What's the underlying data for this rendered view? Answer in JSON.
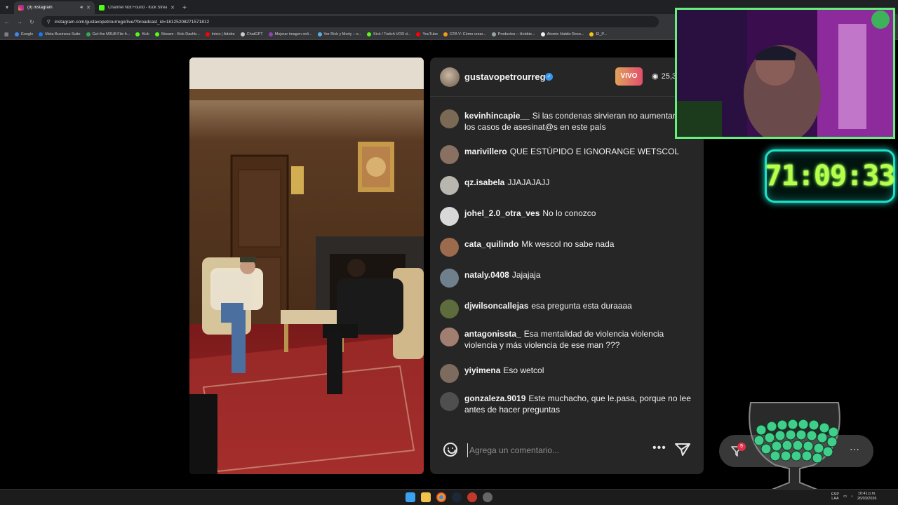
{
  "browser": {
    "tabs": [
      {
        "label": "(9) Instagram",
        "active": true
      },
      {
        "label": "Channel Not Found - Kick Strea...",
        "active": false
      }
    ],
    "url": "instagram.com/gustavopetrourrego/live/?broadcast_id=18125208271571812",
    "bookmarks": [
      {
        "label": "Google",
        "color": "#4285f4"
      },
      {
        "label": "Meta Business Suite",
        "color": "#1877f2"
      },
      {
        "label": "Get the M3U8 File fr...",
        "color": "#34a853"
      },
      {
        "label": "Kick",
        "color": "#53fc18"
      },
      {
        "label": "Stream - Kick Dashb...",
        "color": "#53fc18"
      },
      {
        "label": "Inicio | Adobe",
        "color": "#ff0000"
      },
      {
        "label": "ChatGPT",
        "color": "#cccccc"
      },
      {
        "label": "Mejorar imagen onli...",
        "color": "#8e44ad"
      },
      {
        "label": "Ver Rick y Morty – o...",
        "color": "#5dade2"
      },
      {
        "label": "Kick / Twitch VOD d...",
        "color": "#53fc18"
      },
      {
        "label": "YouTube",
        "color": "#ff0000"
      },
      {
        "label": "GTA V: Cómo crear...",
        "color": "#f39c12"
      },
      {
        "label": "Productos – Hobbie...",
        "color": "#95a5a6"
      },
      {
        "label": "Atomic Habits Reso...",
        "color": "#ecf0f1"
      },
      {
        "label": "El_P...",
        "color": "#f1c40f"
      }
    ]
  },
  "live": {
    "host_name": "gustavopetrourrego",
    "live_label": "VIVO",
    "viewer_count": "25,3",
    "comment_placeholder": "Agrega un comentario..."
  },
  "comments": [
    {
      "user": "kevinhincapie__",
      "text": "Si las condenas sirvieran no aumentaría los casos de asesinat@s en este país",
      "avatar_color": "#7a6a55"
    },
    {
      "user": "marivillero",
      "text": "QUE ESTÚPIDO E IGNORANGE WETSCOL",
      "avatar_color": "#8a7060"
    },
    {
      "user": "qz.isabela",
      "text": "JJAJAJAJJ",
      "avatar_color": "#b9b6b0"
    },
    {
      "user": "johel_2.0_otra_ves",
      "text": "No lo conozco",
      "avatar_color": "#d8d8d8"
    },
    {
      "user": "cata_quilindo",
      "text": "Mk wescol no sabe nada",
      "avatar_color": "#9c6a4c"
    },
    {
      "user": "nataly.0408",
      "text": "Jajajaja",
      "avatar_color": "#6f7f8c"
    },
    {
      "user": "djwilsoncallejas",
      "text": "esa pregunta esta duraaaa",
      "avatar_color": "#5e6b3c"
    },
    {
      "user": "antagonissta_",
      "text": "Esa mentalidad de violencia violencia violencia y más violencia de ese man ???",
      "avatar_color": "#a07e70"
    },
    {
      "user": "yiyimena",
      "text": "Eso wetcol",
      "avatar_color": "#7c6b5e"
    },
    {
      "user": "gonzaleza.9019",
      "text": "Este muchacho, que le.pasa, porque no lee antes de hacer preguntas",
      "avatar_color": "#4f4f4f"
    }
  ],
  "overlay": {
    "timer": "71:09:33",
    "gift_count": "9"
  },
  "taskbar": {
    "lang_1": "ESP",
    "lang_2": "LAA",
    "time": "10:41 p.m.",
    "date": "26/03/2026"
  }
}
